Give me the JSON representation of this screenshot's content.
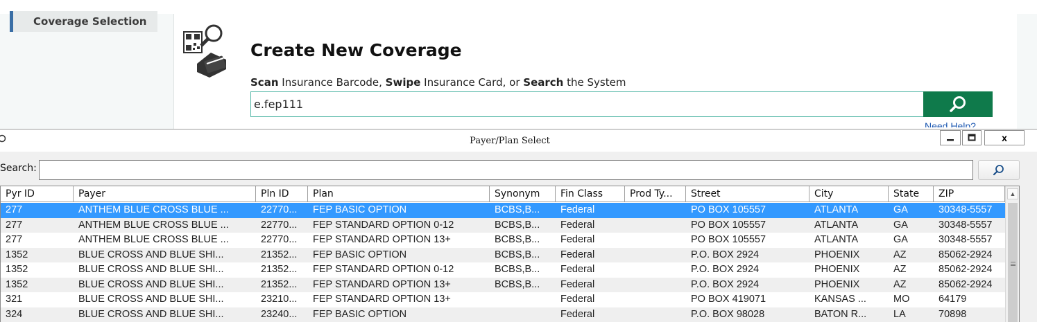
{
  "nav": {
    "coverage_selection": "Coverage Selection"
  },
  "header": {
    "title": "Create New Coverage",
    "instruction": {
      "scan": "Scan",
      "part1": " Insurance Barcode, ",
      "swipe": "Swipe",
      "part2": " Insurance Card, or ",
      "search": "Search",
      "part3": " the System"
    },
    "input_value": "e.fep111",
    "need_help": "Need Help?"
  },
  "dialog": {
    "title": "Payer/Plan Select",
    "close_label": "x",
    "search_label": "Search:",
    "columns": [
      "Pyr ID",
      "Payer",
      "Pln ID",
      "Plan",
      "Synonym",
      "Fin Class",
      "Prod Ty...",
      "Street",
      "City",
      "State",
      "ZIP"
    ],
    "rows": [
      [
        "277",
        "ANTHEM BLUE CROSS BLUE ...",
        "22770...",
        "FEP BASIC OPTION",
        "BCBS,B...",
        "Federal",
        "",
        "PO BOX 105557",
        "ATLANTA",
        "GA",
        "30348-5557"
      ],
      [
        "277",
        "ANTHEM BLUE CROSS BLUE ...",
        "22770...",
        "FEP STANDARD OPTION 0-12",
        "BCBS,B...",
        "Federal",
        "",
        "PO BOX 105557",
        "ATLANTA",
        "GA",
        "30348-5557"
      ],
      [
        "277",
        "ANTHEM BLUE CROSS BLUE ...",
        "22770...",
        "FEP STANDARD OPTION 13+",
        "BCBS,B...",
        "Federal",
        "",
        "PO BOX 105557",
        "ATLANTA",
        "GA",
        "30348-5557"
      ],
      [
        "1352",
        "BLUE CROSS AND BLUE SHI...",
        "21352...",
        "FEP BASIC OPTION",
        "BCBS,B...",
        "Federal",
        "",
        "P.O. BOX 2924",
        "PHOENIX",
        "AZ",
        "85062-2924"
      ],
      [
        "1352",
        "BLUE CROSS AND BLUE SHI...",
        "21352...",
        "FEP STANDARD OPTION 0-12",
        "BCBS,B...",
        "Federal",
        "",
        "P.O. BOX 2924",
        "PHOENIX",
        "AZ",
        "85062-2924"
      ],
      [
        "1352",
        "BLUE CROSS AND BLUE SHI...",
        "21352...",
        "FEP STANDARD OPTION 13+",
        "BCBS,B...",
        "Federal",
        "",
        "P.O. BOX 2924",
        "PHOENIX",
        "AZ",
        "85062-2924"
      ],
      [
        "321",
        "BLUE CROSS AND BLUE SHI...",
        "23210...",
        "FEP STANDARD OPTION 13+",
        "",
        "Federal",
        "",
        "PO BOX 419071",
        "KANSAS ...",
        "MO",
        "64179"
      ],
      [
        "324",
        "BLUE CROSS AND BLUE SHI...",
        "23240...",
        "FEP BASIC OPTION",
        "",
        "Federal",
        "",
        "P.O. BOX 98028",
        "BATON R...",
        "LA",
        "70898"
      ]
    ]
  },
  "colors": {
    "accent_green": "#0f7a4b",
    "selection": "#3399ff",
    "nav_bar": "#3a6ea5"
  }
}
